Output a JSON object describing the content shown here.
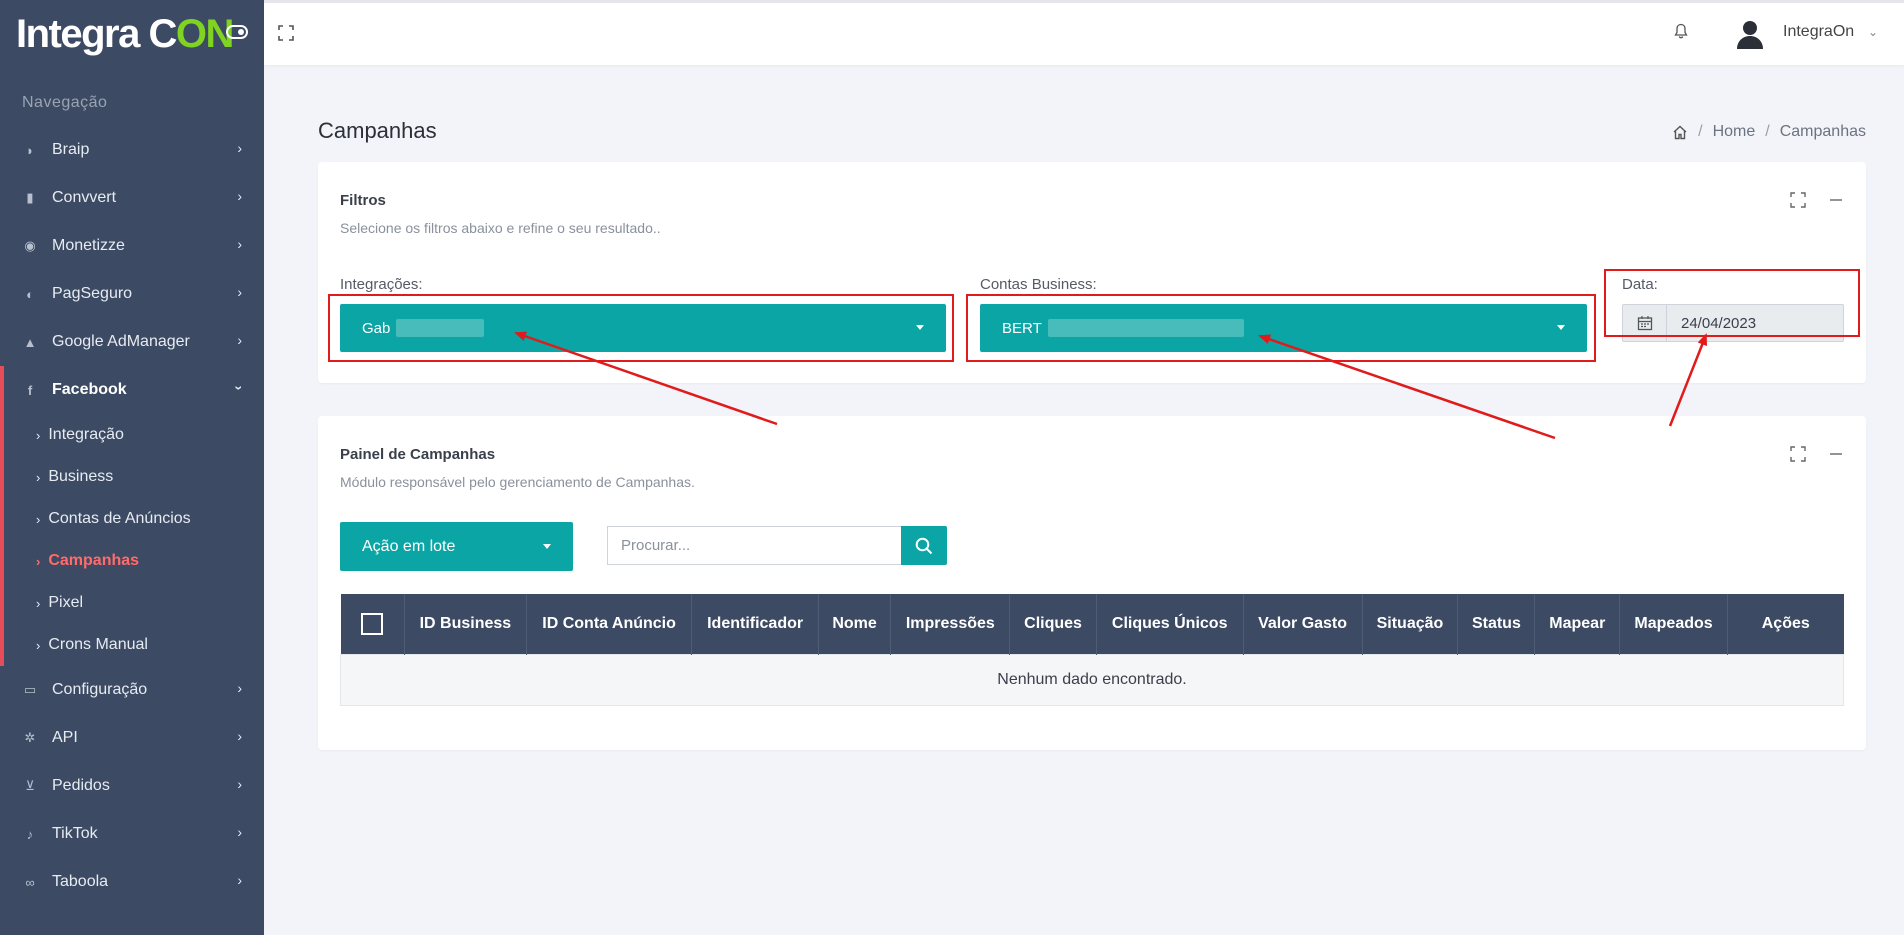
{
  "brand": {
    "name_main": "Integra ",
    "name_c": "C",
    "name_on": "ON"
  },
  "sidebar": {
    "caption": "Navegação",
    "items_top": [
      {
        "label": "Braip",
        "icon": "braip-icon"
      },
      {
        "label": "Convvert",
        "icon": "bar-chart-icon"
      },
      {
        "label": "Monetizze",
        "icon": "coin-icon"
      },
      {
        "label": "PagSeguro",
        "icon": "pagseguro-icon"
      },
      {
        "label": "Google AdManager",
        "icon": "admanager-icon"
      }
    ],
    "facebook": {
      "label": "Facebook",
      "children": [
        "Integração",
        "Business",
        "Contas de Anúncios",
        "Campanhas",
        "Pixel",
        "Crons Manual"
      ]
    },
    "items_bottom": [
      {
        "label": "Configuração",
        "icon": "monitor-icon"
      },
      {
        "label": "API",
        "icon": "gear-icon"
      },
      {
        "label": "Pedidos",
        "icon": "cart-icon"
      },
      {
        "label": "TikTok",
        "icon": "tiktok-icon"
      },
      {
        "label": "Taboola",
        "icon": "taboola-icon"
      }
    ]
  },
  "topbar": {
    "user_name": "IntegraOn"
  },
  "page": {
    "title": "Campanhas",
    "breadcrumb": {
      "home": "Home",
      "current": "Campanhas"
    }
  },
  "filters": {
    "title": "Filtros",
    "subtitle": "Selecione os filtros abaixo e refine o seu resultado..",
    "integracoes_label": "Integrações:",
    "integracoes_value": "Gab",
    "contas_label": "Contas Business:",
    "contas_value": "BERT",
    "data_label": "Data:",
    "data_value": "24/04/2023"
  },
  "panel": {
    "title": "Painel de Campanhas",
    "subtitle": "Módulo responsável pelo gerenciamento de Campanhas.",
    "bulk_action": "Ação em lote",
    "search_placeholder": "Procurar...",
    "columns": [
      "ID Business",
      "ID Conta Anúncio",
      "Identificador",
      "Nome",
      "Impressões",
      "Cliques",
      "Cliques Únicos",
      "Valor Gasto",
      "Situação",
      "Status",
      "Mapear",
      "Mapeados",
      "Ações"
    ],
    "empty_message": "Nenhum dado encontrado."
  },
  "colors": {
    "sidebar_bg": "#3c4a63",
    "accent_teal": "#0ba5a5",
    "active_red": "#ff6b6b",
    "annotation_red": "#e01b1b"
  }
}
